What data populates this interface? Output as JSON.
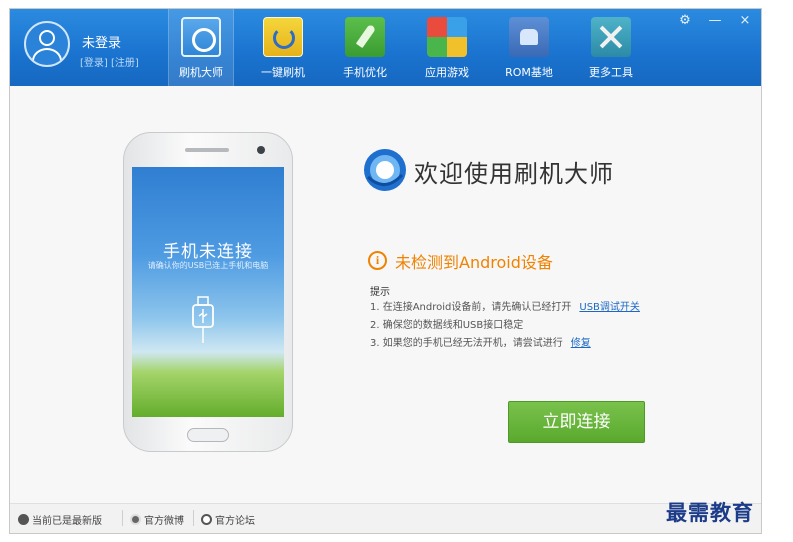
{
  "user": {
    "name": "未登录",
    "login_label": "[登录]",
    "register_label": "[注册]"
  },
  "nav": {
    "items": [
      {
        "label": "刷机大师",
        "icon": "flash-master-icon",
        "active": true
      },
      {
        "label": "一键刷机",
        "icon": "one-key-flash-icon",
        "active": false
      },
      {
        "label": "手机优化",
        "icon": "rocket-icon",
        "active": false
      },
      {
        "label": "应用游戏",
        "icon": "apps-grid-icon",
        "active": false
      },
      {
        "label": "ROM基地",
        "icon": "android-icon",
        "active": false
      },
      {
        "label": "更多工具",
        "icon": "tools-icon",
        "active": false
      }
    ]
  },
  "window_controls": {
    "settings": "⚙",
    "minimize": "—",
    "close": "×"
  },
  "phone": {
    "title": "手机未连接",
    "subtitle": "请确认你的USB已连上手机和电脑"
  },
  "main": {
    "welcome": "欢迎使用刷机大师",
    "alert": "未检测到Android设备",
    "tips_title": "提示",
    "tips": [
      {
        "text": "1. 在连接Android设备前，请先确认已经打开",
        "link": "USB调试开关"
      },
      {
        "text": "2. 确保您的数据线和USB接口稳定",
        "link": ""
      },
      {
        "text": "3. 如果您的手机已经无法开机，请尝试进行",
        "link": "修复"
      }
    ],
    "connect_button": "立即连接"
  },
  "status": {
    "version": "当前已是最新版",
    "weibo": "官方微博",
    "forum": "官方论坛"
  },
  "watermark": "最需教育",
  "colors": {
    "header": "#1a73cf",
    "accent": "#f08200",
    "button": "#5aa92e",
    "link": "#1d68c4"
  }
}
